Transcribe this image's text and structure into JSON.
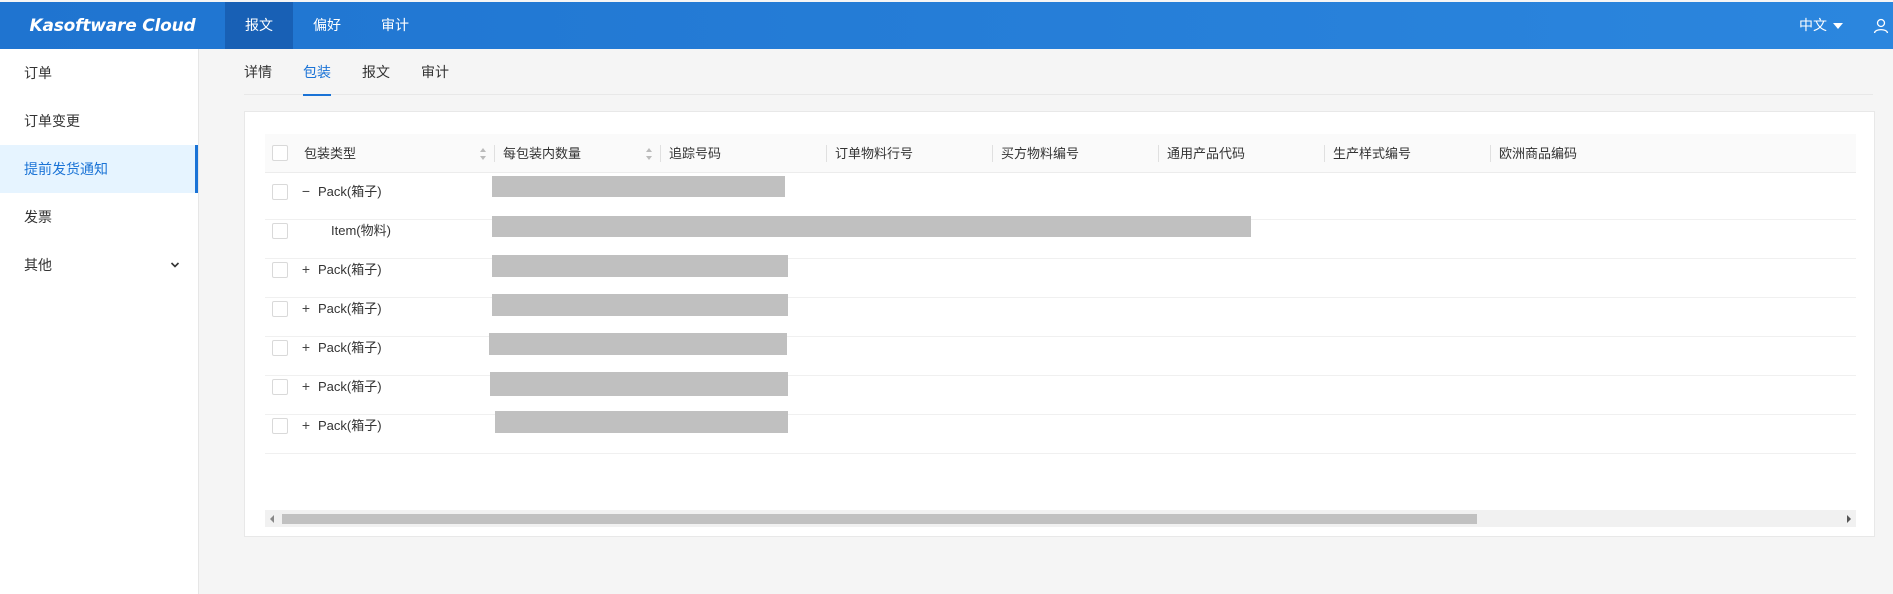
{
  "app": {
    "brand": "Kasoftware Cloud",
    "top_nav": [
      "报文",
      "偏好",
      "审计"
    ],
    "language": "中文",
    "accent_color": "#1a73d6"
  },
  "sidebar": {
    "items": [
      {
        "label": "订单"
      },
      {
        "label": "订单变更"
      },
      {
        "label": "提前发货通知",
        "active": true
      },
      {
        "label": "发票"
      },
      {
        "label": "其他",
        "has_children": true
      }
    ]
  },
  "tabs": [
    "详情",
    "包装",
    "报文",
    "审计"
  ],
  "active_tab": "包装",
  "table": {
    "columns": [
      "包装类型",
      "每包装内数量",
      "追踪号码",
      "订单物料行号",
      "买方物料编号",
      "通用产品代码",
      "生产样式编号",
      "欧洲商品编码"
    ],
    "rows": [
      {
        "type": "Pack(箱子)",
        "toggle": "−"
      },
      {
        "type": "Item(物料)",
        "toggle": ""
      },
      {
        "type": "Pack(箱子)",
        "toggle": "+"
      },
      {
        "type": "Pack(箱子)",
        "toggle": "+"
      },
      {
        "type": "Pack(箱子)",
        "toggle": "+"
      },
      {
        "type": "Pack(箱子)",
        "toggle": "+"
      },
      {
        "type": "Pack(箱子)",
        "toggle": "+"
      }
    ]
  }
}
